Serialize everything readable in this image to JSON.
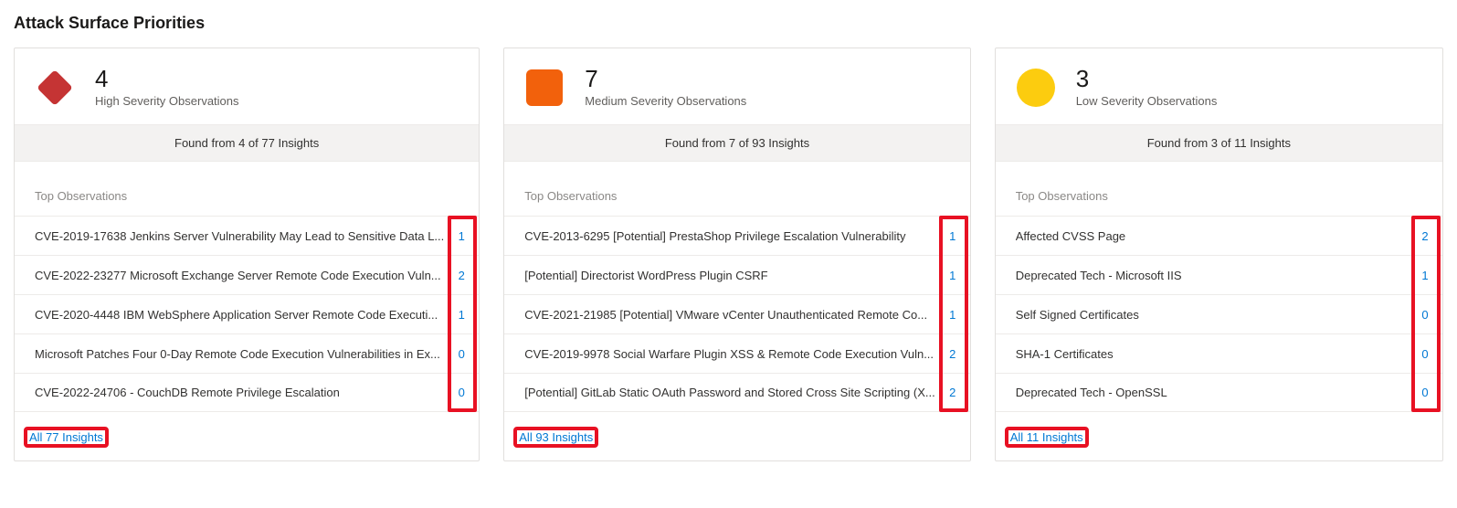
{
  "section_title": "Attack Surface Priorities",
  "top_observations_label": "Top Observations",
  "cards": [
    {
      "severity_key": "high",
      "count": "4",
      "label": "High Severity Observations",
      "found_text": "Found from 4 of 77 Insights",
      "all_link": "All 77 Insights",
      "observations": [
        {
          "title": "CVE-2019-17638 Jenkins Server Vulnerability May Lead to Sensitive Data L...",
          "count": "1"
        },
        {
          "title": "CVE-2022-23277 Microsoft Exchange Server Remote Code Execution Vuln...",
          "count": "2"
        },
        {
          "title": "CVE-2020-4448 IBM WebSphere Application Server Remote Code Executi...",
          "count": "1"
        },
        {
          "title": "Microsoft Patches Four 0-Day Remote Code Execution Vulnerabilities in Ex...",
          "count": "0"
        },
        {
          "title": "CVE-2022-24706 - CouchDB Remote Privilege Escalation",
          "count": "0"
        }
      ]
    },
    {
      "severity_key": "medium",
      "count": "7",
      "label": "Medium Severity Observations",
      "found_text": "Found from 7 of 93 Insights",
      "all_link": "All 93 Insights",
      "observations": [
        {
          "title": "CVE-2013-6295 [Potential] PrestaShop Privilege Escalation Vulnerability",
          "count": "1"
        },
        {
          "title": "[Potential] Directorist WordPress Plugin CSRF",
          "count": "1"
        },
        {
          "title": "CVE-2021-21985 [Potential] VMware vCenter Unauthenticated Remote Co...",
          "count": "1"
        },
        {
          "title": "CVE-2019-9978 Social Warfare Plugin XSS & Remote Code Execution Vuln...",
          "count": "2"
        },
        {
          "title": "[Potential] GitLab Static OAuth Password and Stored Cross Site Scripting (X...",
          "count": "2"
        }
      ]
    },
    {
      "severity_key": "low",
      "count": "3",
      "label": "Low Severity Observations",
      "found_text": "Found from 3 of 11 Insights",
      "all_link": "All 11 Insights",
      "observations": [
        {
          "title": "Affected CVSS Page",
          "count": "2"
        },
        {
          "title": "Deprecated Tech - Microsoft IIS",
          "count": "1"
        },
        {
          "title": "Self Signed Certificates",
          "count": "0"
        },
        {
          "title": "SHA-1 Certificates",
          "count": "0"
        },
        {
          "title": "Deprecated Tech - OpenSSL",
          "count": "0"
        }
      ]
    }
  ]
}
